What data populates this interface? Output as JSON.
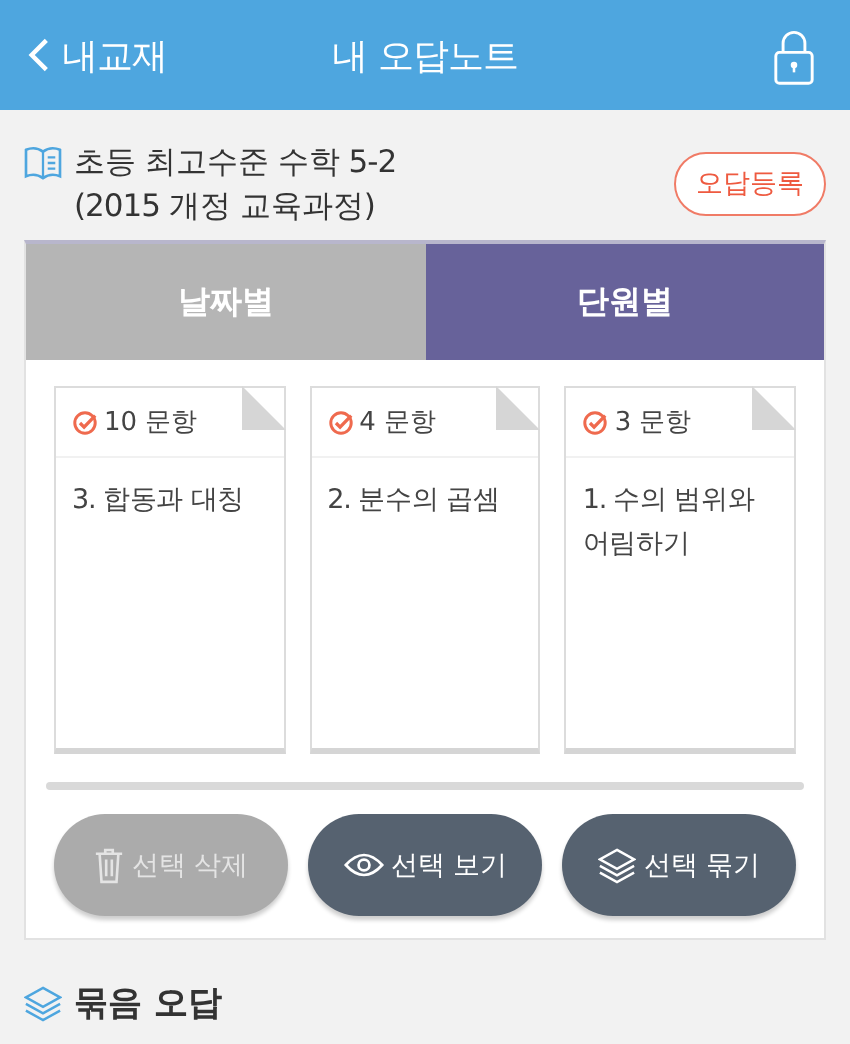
{
  "header": {
    "back_label": "내교재",
    "title": "내 오답노트"
  },
  "book": {
    "title_line1": "초등 최고수준 수학 5-2",
    "title_line2": "(2015 개정 교육과정)",
    "register_button": "오답등록"
  },
  "tabs": [
    {
      "label": "날짜별",
      "selected": false
    },
    {
      "label": "단원별",
      "selected": true
    }
  ],
  "cards": [
    {
      "count": "10 문항",
      "unit": "3. 합동과 대칭",
      "checked": true
    },
    {
      "count": "4 문항",
      "unit": "2. 분수의 곱셈",
      "checked": true
    },
    {
      "count": "3 문항",
      "unit": "1. 수의 범위와 어림하기",
      "checked": true
    }
  ],
  "buttons": [
    {
      "kind": "delete",
      "label": "선택 삭제",
      "disabled": true
    },
    {
      "kind": "view",
      "label": "선택 보기",
      "disabled": false
    },
    {
      "kind": "bundle",
      "label": "선택 묶기",
      "disabled": false
    }
  ],
  "section": {
    "title": "묶음 오답"
  }
}
